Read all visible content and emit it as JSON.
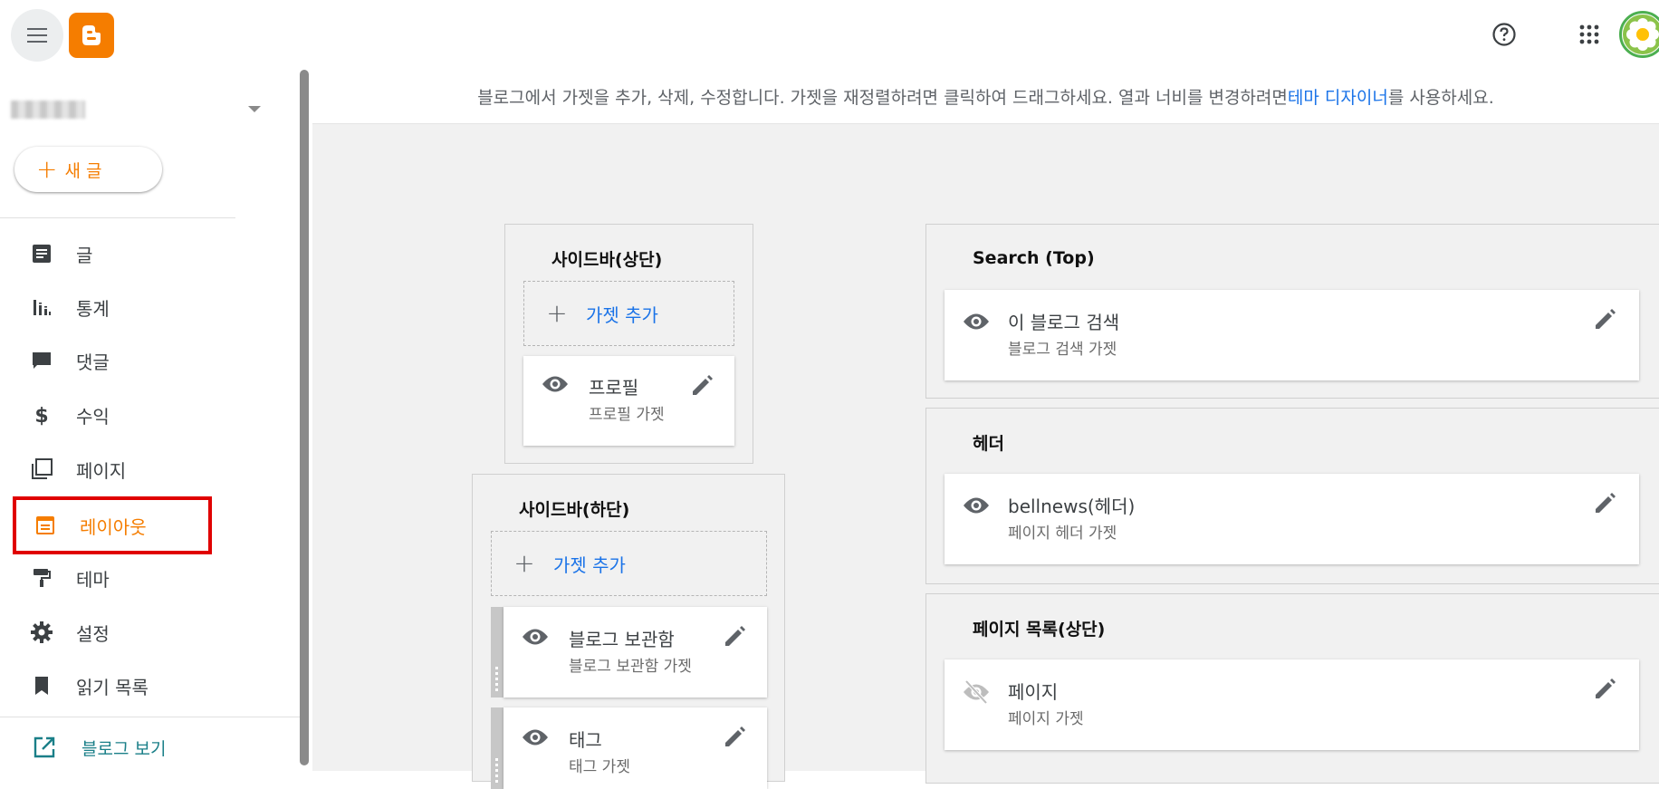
{
  "sidebar": {
    "new_post_label": "새 글",
    "items": [
      {
        "label": "글",
        "icon": "posts-icon"
      },
      {
        "label": "통계",
        "icon": "stats-icon"
      },
      {
        "label": "댓글",
        "icon": "comments-icon"
      },
      {
        "label": "수익",
        "icon": "earnings-icon"
      },
      {
        "label": "페이지",
        "icon": "pages-icon"
      },
      {
        "label": "레이아웃",
        "icon": "layout-icon",
        "active": true
      },
      {
        "label": "테마",
        "icon": "theme-icon"
      },
      {
        "label": "설정",
        "icon": "settings-icon"
      },
      {
        "label": "읽기 목록",
        "icon": "reading-list-icon"
      }
    ],
    "view_blog_label": "블로그 보기"
  },
  "infobar": {
    "text_before": "블로그에서 가젯을 추가, 삭제, 수정합니다. 가젯을 재정렬하려면 클릭하여 드래그하세요. 열과 너비를 변경하려면 ",
    "link": "테마 디자이너",
    "text_after": "를 사용하세요."
  },
  "add_gadget_label": "가젯 추가",
  "sections": {
    "sidebar_top": {
      "title": "사이드바(상단)",
      "gadgets": [
        {
          "title": "프로필",
          "subtitle": "프로필 가젯"
        }
      ]
    },
    "sidebar_bottom": {
      "title": "사이드바(하단)",
      "gadgets": [
        {
          "title": "블로그 보관함",
          "subtitle": "블로그 보관함 가젯"
        },
        {
          "title": "태그",
          "subtitle": "태그 가젯"
        }
      ]
    },
    "search_top": {
      "title": "Search (Top)",
      "gadgets": [
        {
          "title": "이 블로그 검색",
          "subtitle": "블로그 검색 가젯"
        }
      ]
    },
    "header": {
      "title": "헤더",
      "gadgets": [
        {
          "title": "bellnews(헤더)",
          "subtitle": "페이지 헤더 가젯"
        }
      ]
    },
    "page_list_top": {
      "title": "페이지 목록(상단)",
      "gadgets": [
        {
          "title": "페이지",
          "subtitle": "페이지 가젯",
          "hidden": true
        }
      ]
    }
  },
  "colors": {
    "brand_orange": "#f57d00",
    "link_blue": "#1a73e8",
    "view_blog_teal": "#1a7f88",
    "active_outline": "#e00000"
  }
}
